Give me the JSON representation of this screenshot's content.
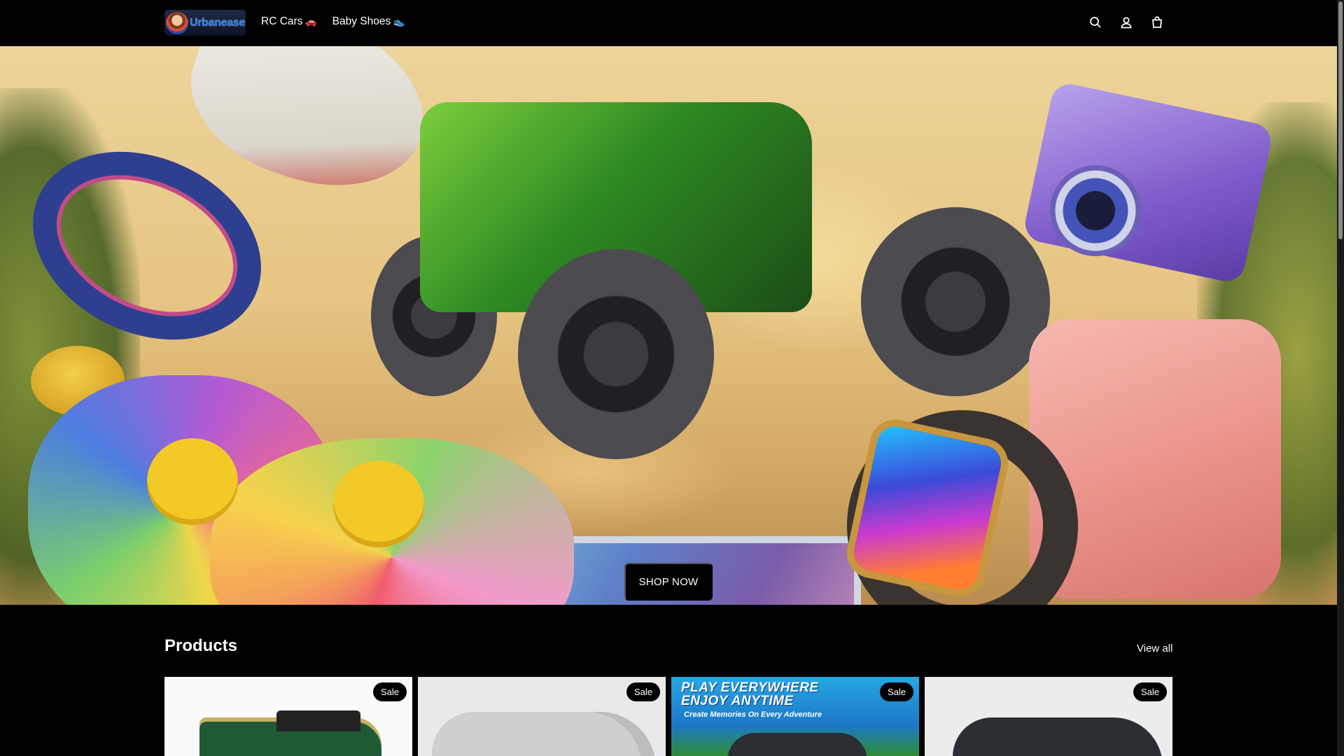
{
  "brand": {
    "name": "Urbanease"
  },
  "nav": {
    "items": [
      {
        "label": "RC Cars",
        "emoji": "🚗"
      },
      {
        "label": "Baby Shoes",
        "emoji": "👟"
      }
    ]
  },
  "header_icons": [
    "search-icon",
    "account-icon",
    "cart-icon"
  ],
  "hero": {
    "button_label": "SHOP NOW"
  },
  "products": {
    "title": "Products",
    "view_all": "View all",
    "cards": [
      {
        "badge": "Sale"
      },
      {
        "badge": "Sale"
      },
      {
        "badge": "Sale",
        "promo_line1": "PLAY EVERYWHERE",
        "promo_line2": "ENJOY ANYTIME",
        "promo_line3": "Create Memories On Every Adventure"
      },
      {
        "badge": "Sale"
      }
    ]
  },
  "colors": {
    "header_bg": "#000000",
    "button_bg": "#000000",
    "badge_bg": "#000000",
    "logo_text": "#2f7ee0"
  }
}
